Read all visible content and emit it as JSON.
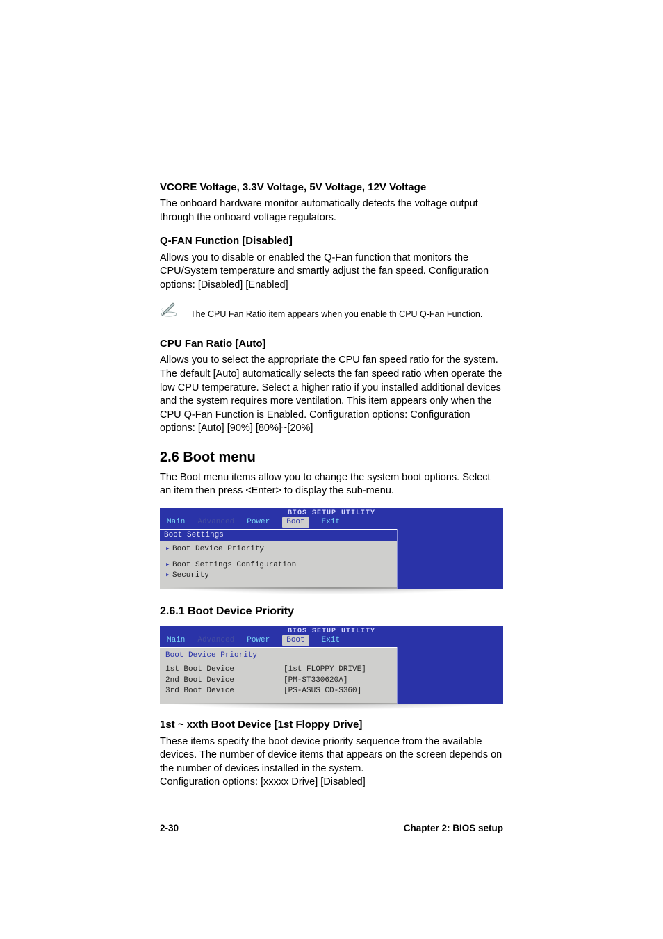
{
  "sections": {
    "s1": {
      "title": "VCORE Voltage, 3.3V Voltage, 5V Voltage, 12V Voltage",
      "body": "The onboard hardware monitor automatically detects the voltage output through the onboard voltage regulators."
    },
    "s2": {
      "title": "Q-FAN Function [Disabled]",
      "body": "Allows you to disable or enabled the Q-Fan function that monitors the CPU/System temperature and smartly adjust the fan speed. Configuration options: [Disabled] [Enabled]"
    },
    "note1": "The CPU Fan Ratio item appears when you enable th CPU Q-Fan Function.",
    "s3": {
      "title": "CPU Fan Ratio [Auto]",
      "body": "Allows you to select the appropriate the CPU fan speed ratio for the system. The default [Auto] automatically selects the fan speed ratio when operate the  low CPU temperature. Select a higher ratio if you installed additional devices and the system requires more ventilation. This item appears only when the CPU Q-Fan Function is Enabled. Configuration options: Configuration options: [Auto] [90%] [80%]~[20%]"
    },
    "h26": "2.6    Boot menu",
    "h26_body": "The Boot menu items allow you to change the system boot options. Select an item then press <Enter> to display the sub-menu.",
    "h261": "2.6.1   Boot Device Priority",
    "s4": {
      "title": "1st ~ xxth Boot Device [1st Floppy Drive]",
      "body1": "These items specify the boot device priority sequence from the available devices. The number of device items that appears on the screen depends on the number of devices installed in the system.",
      "body2": "Configuration options: [xxxxx Drive] [Disabled]"
    }
  },
  "bios": {
    "title": "BIOS SETUP UTILITY",
    "tabs": [
      "Main",
      "Advanced",
      "Power",
      "Boot",
      "Exit"
    ],
    "screen1": {
      "heading": "Boot Settings",
      "items": [
        "Boot Device Priority",
        "Boot Settings Configuration",
        "Security"
      ]
    },
    "screen2": {
      "heading": "Boot Device Priority",
      "rows": [
        {
          "label": "1st Boot Device",
          "value": "[1st FLOPPY DRIVE]"
        },
        {
          "label": "2nd Boot Device",
          "value": "[PM-ST330620A]"
        },
        {
          "label": "3rd Boot Device",
          "value": "[PS-ASUS CD-S360]"
        }
      ]
    }
  },
  "footer": {
    "left": "2-30",
    "right": "Chapter 2: BIOS setup"
  },
  "icons": {
    "pen": "pen-icon"
  }
}
